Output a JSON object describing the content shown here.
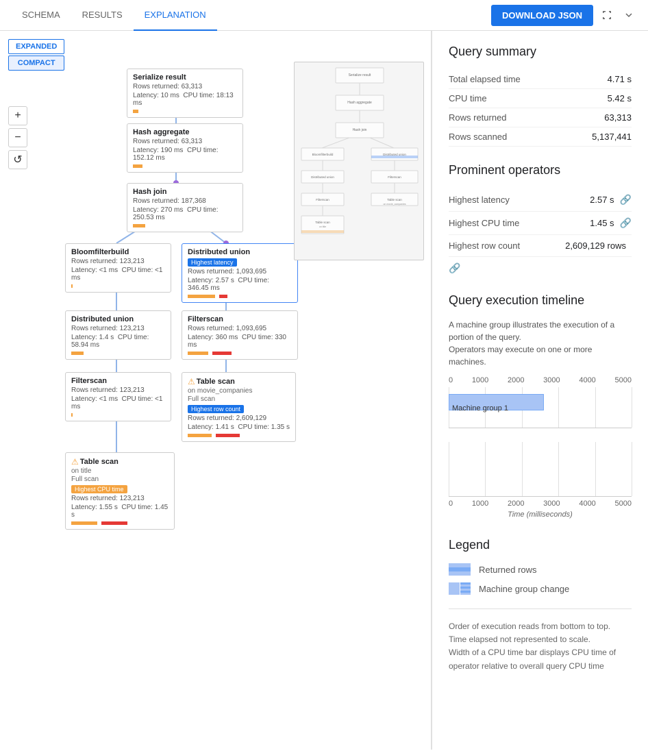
{
  "nav": {
    "tabs": [
      "SCHEMA",
      "RESULTS",
      "EXPLANATION"
    ],
    "active_tab": "EXPLANATION"
  },
  "toolbar": {
    "download_label": "DOWNLOAD JSON"
  },
  "view_toggle": {
    "expanded": "EXPANDED",
    "compact": "COMPACT",
    "active": "COMPACT"
  },
  "zoom": {
    "plus": "+",
    "minus": "−",
    "reset": "↺"
  },
  "nodes": {
    "serialize": {
      "title": "Serialize result",
      "rows": "Rows returned: 63,313",
      "latency": "Latency: 10 ms",
      "cpu": "CPU time: 18:13 ms"
    },
    "hash_aggregate": {
      "title": "Hash aggregate",
      "rows": "Rows returned: 63,313",
      "latency": "Latency: 190 ms",
      "cpu": "CPU time: 152.12 ms"
    },
    "hash_join": {
      "title": "Hash join",
      "rows": "Rows returned: 187,368",
      "latency": "Latency: 270 ms",
      "cpu": "CPU time: 250.53 ms"
    },
    "bloomfilter": {
      "title": "Bloomfilterbuild",
      "rows": "Rows returned: 123,213",
      "latency": "Latency: <1 ms",
      "cpu": "CPU time: <1 ms"
    },
    "dist_union_1": {
      "title": "Distributed union",
      "rows": "Rows returned: 1,093,695",
      "latency": "Latency: 2.57 s",
      "cpu": "CPU time: 346.45 ms",
      "badge": "Highest latency"
    },
    "dist_union_2": {
      "title": "Distributed union",
      "rows": "Rows returned: 123,213",
      "latency": "Latency: 1.4 s",
      "cpu": "CPU time: 58.94 ms"
    },
    "filterscan_1": {
      "title": "Filterscan",
      "rows": "Rows returned: 1,093,695",
      "latency": "Latency: 360 ms",
      "cpu": "CPU time: 330 ms"
    },
    "filterscan_2": {
      "title": "Filterscan",
      "rows": "Rows returned: 123,213",
      "latency": "Latency: <1 ms",
      "cpu": "CPU time: <1 ms"
    },
    "table_scan_companies": {
      "title": "Table scan",
      "subtitle": "on movie_companies",
      "scan_type": "Full scan",
      "badge": "Highest row count",
      "rows": "Rows returned: 2,609,129",
      "latency": "Latency: 1.41 s",
      "cpu": "CPU time: 1.35 s"
    },
    "table_scan_title": {
      "title": "Table scan",
      "subtitle": "on title",
      "scan_type": "Full scan",
      "badge": "Highest CPU time",
      "rows": "Rows returned: 123,213",
      "latency": "Latency: 1.55 s",
      "cpu": "CPU time: 1.45 s"
    }
  },
  "query_summary": {
    "title": "Query summary",
    "rows": [
      {
        "label": "Total elapsed time",
        "value": "4.71 s"
      },
      {
        "label": "CPU time",
        "value": "5.42 s"
      },
      {
        "label": "Rows returned",
        "value": "63,313"
      },
      {
        "label": "Rows scanned",
        "value": "5,137,441"
      }
    ]
  },
  "prominent_operators": {
    "title": "Prominent operators",
    "rows": [
      {
        "label": "Highest latency",
        "value": "2.57 s"
      },
      {
        "label": "Highest CPU time",
        "value": "1.45 s"
      },
      {
        "label": "Highest row count",
        "value": "2,609,129 rows"
      }
    ]
  },
  "timeline": {
    "title": "Query execution timeline",
    "desc1": "A machine group illustrates the execution of a portion of the query.",
    "desc2": "Operators may execute on one or more machines.",
    "axis_top": [
      "0",
      "1000",
      "2000",
      "3000",
      "4000",
      "5000"
    ],
    "axis_bottom": [
      "0",
      "1000",
      "2000",
      "3000",
      "4000",
      "5000"
    ],
    "xlabel": "Time (milliseconds)",
    "machine_group": {
      "label": "Machine group 1",
      "start_pct": 0,
      "width_pct": 52
    }
  },
  "legend": {
    "title": "Legend",
    "items": [
      {
        "label": "Returned rows",
        "color1": "#a8c4f5",
        "color2": "#7aabf5"
      },
      {
        "label": "Machine group change",
        "color1": "#a8c4f5",
        "color2": "#7aabf5"
      }
    ]
  },
  "footer": {
    "lines": [
      "Order of execution reads from bottom to top.",
      "Time elapsed not represented to scale.",
      "Width of a CPU time bar displays CPU time of operator relative to overall query CPU time"
    ]
  }
}
